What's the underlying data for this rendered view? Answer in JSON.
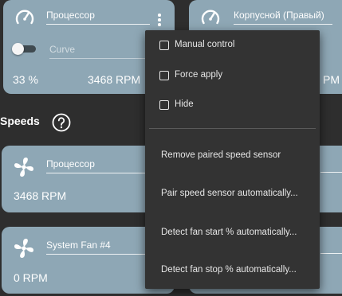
{
  "control_cards": [
    {
      "name": "Процессор",
      "mode_placeholder": "Curve",
      "percent": "33 %",
      "rpm": "3468 RPM",
      "enabled": false
    },
    {
      "name": "Корпусной (Правый)",
      "rpm_partial": "PM"
    }
  ],
  "speeds": {
    "title": "Speeds",
    "cards": [
      {
        "name": "Процессор",
        "rpm": "3468 RPM"
      },
      {
        "name": "System Fan #4",
        "rpm": "0 RPM"
      }
    ]
  },
  "menu": {
    "checkbox_items": [
      {
        "label": "Manual control",
        "checked": false
      },
      {
        "label": "Force apply",
        "checked": false
      },
      {
        "label": "Hide",
        "checked": false
      }
    ],
    "action_items": [
      {
        "label": "Remove paired speed sensor"
      },
      {
        "label": "Pair speed sensor automatically..."
      },
      {
        "label": "Detect fan start % automatically..."
      },
      {
        "label": "Detect fan stop % automatically..."
      }
    ]
  },
  "colors": {
    "card": "#8ea7b5",
    "background": "#2e2e2e",
    "menu": "#333333"
  },
  "icons": {
    "control": "gauge-icon",
    "speed": "fan-icon",
    "help": "help-circle-icon",
    "menu": "kebab-menu-icon"
  }
}
